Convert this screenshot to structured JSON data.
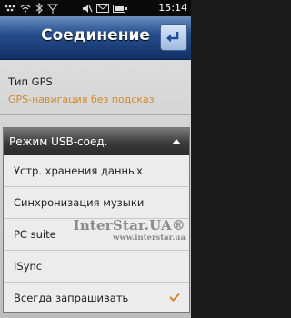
{
  "statusbar": {
    "icons": [
      "dots-icon",
      "wifi-icon",
      "bluetooth-icon",
      "signal-icon",
      "mute-icon",
      "message-icon",
      "battery-icon"
    ],
    "time": "15:14"
  },
  "header": {
    "title": "Соединение"
  },
  "gps": {
    "label": "Тип GPS",
    "value": "GPS-навигация без подсказ."
  },
  "usb_popup": {
    "title": "Режим USB-соед.",
    "options": [
      {
        "label": "Устр. хранения данных",
        "selected": false
      },
      {
        "label": "Синхронизация музыки",
        "selected": false
      },
      {
        "label": "PC suite",
        "selected": false
      },
      {
        "label": "ISync",
        "selected": false
      },
      {
        "label": "Всегда запрашивать",
        "selected": true
      }
    ]
  },
  "watermark": {
    "brand": "InterStar.UA®",
    "url": "www.interstar.ua"
  },
  "colors": {
    "accent_orange": "#d08a2a",
    "header_blue": "#27508f"
  }
}
